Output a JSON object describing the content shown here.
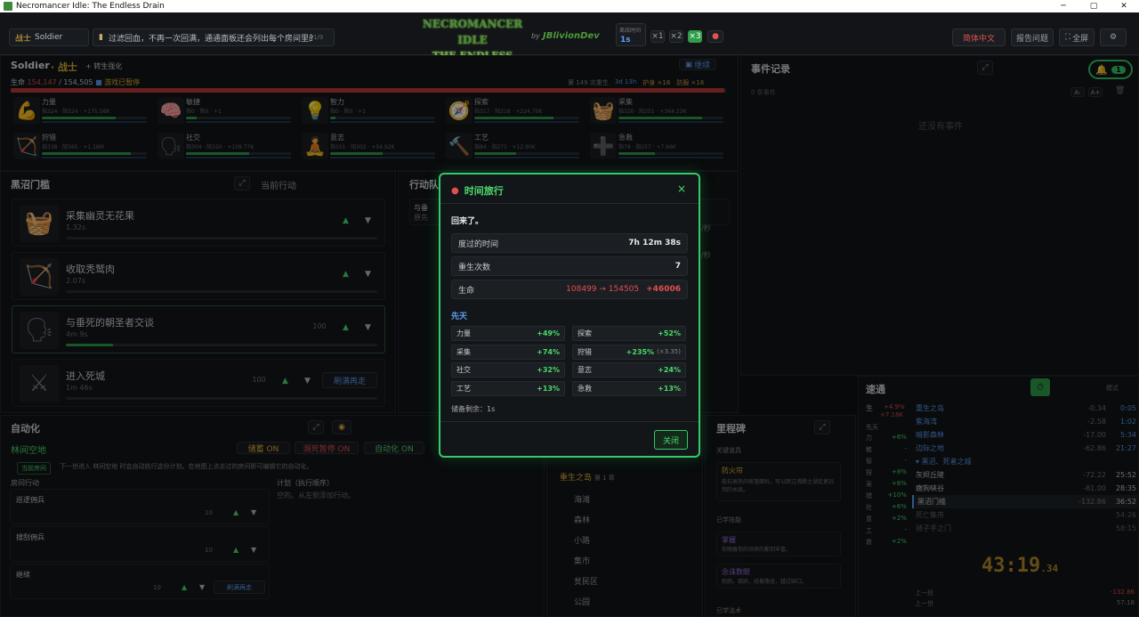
{
  "window": {
    "title": "Necromancer Idle: The Endless Drain",
    "minimize": "─",
    "maximize": "▢",
    "close": "✕"
  },
  "topbar": {
    "class_label": "战士",
    "class_value": "Soldier",
    "hint": "过滤回血，不再一次回满，通通面板还会列出每个房间里的",
    "hint_page": "1/9",
    "logo_line1": "NECROMANCER IDLE",
    "logo_line2": "THE ENDLESS DRAIN",
    "by": "by",
    "author": "JBlivionDev",
    "speed_label": "离线时间",
    "speed_value": "1s",
    "speed_x1": "×1",
    "speed_x2": "×2",
    "speed_x3": "×3",
    "language": "简体中文",
    "report": "报告问题",
    "fullscreen": "全屏"
  },
  "char": {
    "name": "Soldier",
    "title": "· 战士",
    "rebirth_upgrade": "+ 转生强化",
    "continue": "继续",
    "life_label": "生命",
    "life_value": "154,147",
    "life_max": "/ 154,505",
    "status": "游戏已暂停",
    "rebirth_count": "第 149 次重生",
    "time_played": "3d 13h",
    "shield": "护身 ×16",
    "armor": "防服 ×16",
    "life_ratio": 0.998
  },
  "stats": [
    {
      "icon": "💪",
      "name": "力量",
      "sub": "指324 · 阳324 · +175.58K",
      "p": 0.7
    },
    {
      "icon": "🧠",
      "name": "敏捷",
      "sub": "指0 · 阳0 · +1",
      "p": 0.1
    },
    {
      "icon": "💡",
      "name": "智力",
      "sub": "指0 · 阳0 · +1",
      "p": 0.05
    },
    {
      "icon": "🧭",
      "name": "探索",
      "sub": "指317 · 阳318 · +224.70K",
      "p": 0.75
    },
    {
      "icon": "🧺",
      "name": "采集",
      "sub": "指320 · 阳351 · +364.23K",
      "p": 0.8
    },
    {
      "icon": "🏹",
      "name": "狩猎",
      "sub": "指338 · 阳365 · +1.18M",
      "p": 0.85
    },
    {
      "icon": "🗣",
      "name": "社交",
      "sub": "指304 · 阳320 · +109.77K",
      "p": 0.6
    },
    {
      "icon": "🧘",
      "name": "意志",
      "sub": "指101 · 阳302 · +54.92K",
      "p": 0.5
    },
    {
      "icon": "🔨",
      "name": "工艺",
      "sub": "指84 · 阳271 · +12.90K",
      "p": 0.4
    },
    {
      "icon": "➕",
      "name": "急救",
      "sub": "指79 · 阳257 · +7.66K",
      "p": 0.35
    }
  ],
  "location": {
    "title": "黑沼门槛",
    "current_action": "当前行动"
  },
  "actions": [
    {
      "icon": "🧺",
      "name": "采集幽灵无花果",
      "time": "1.32s",
      "count": "",
      "p": 0
    },
    {
      "icon": "🏹",
      "name": "收取秃鹫肉",
      "time": "2.07s",
      "count": "",
      "p": 0
    },
    {
      "icon": "🗣",
      "name": "与垂死的朝圣者交谈",
      "time": "4m 9s",
      "count": "100",
      "p": 0.15
    },
    {
      "icon": "⚔",
      "name": "进入死城",
      "time": "1m 46s",
      "count": "100",
      "p": 0,
      "extra": "刷满再走"
    }
  ],
  "queue": {
    "title": "行动队",
    "item1": "与垂",
    "item1sub": "原先",
    "per": "/秒",
    "per2": "/秒"
  },
  "events": {
    "title": "事件记录",
    "count": "0 条事件",
    "empty": "还没有事件",
    "badge": "1",
    "font_small": "A-",
    "font_big": "A+"
  },
  "automation": {
    "title": "自动化",
    "zone": "林间空地",
    "btn_save": "储蓄 ON",
    "btn_pause": "濒死暂停 ON",
    "btn_auto": "自动化 ON",
    "current": "当前房间",
    "desc": "下一世进入 林间空地 时会自动执行这份计划。在地图上点去过的房间即可编辑它的自动化。",
    "room_actions": "房间行动",
    "plan": "计划（执行顺序）",
    "plan_empty": "空的。从左侧添加行动。",
    "rows": [
      {
        "name": "巡逻佣兵",
        "count": "10"
      },
      {
        "name": "搜刮佣兵",
        "count": "10"
      },
      {
        "name": "继续",
        "count": "10",
        "extra": "刷满再走"
      }
    ]
  },
  "map": {
    "chapter": "重生之岛",
    "chapter_no": "第 1 章",
    "items": [
      "海滩",
      "森林",
      "小路",
      "集市",
      "贫民区",
      "公园"
    ]
  },
  "milestones": {
    "title": "里程碑",
    "key_items": "关键道具",
    "item_name": "防火帘",
    "item_desc": "能抗高热的帐篷面料，可以跨过沸腾之湖走更远到的水底。",
    "learned": "已学技能",
    "skill1": "掌握",
    "skill1desc": "你随着你的领来的都到丰富。",
    "skill2": "念诛数眼",
    "skill2desc": "助跑，跳跃，经着路径，越过缺口。",
    "magic": "已学法术"
  },
  "speedrun": {
    "title": "速通",
    "mode": "模式",
    "life_label": "生",
    "life_delta": "+4.9%",
    "life_delta2": "+7.18K",
    "innate": "先天",
    "deltas": [
      {
        "k": "力",
        "v": "+6%"
      },
      {
        "k": "敏",
        "v": "-"
      },
      {
        "k": "智",
        "v": "-"
      },
      {
        "k": "探",
        "v": "+8%"
      },
      {
        "k": "采",
        "v": "+6%"
      },
      {
        "k": "猎",
        "v": "+10%"
      },
      {
        "k": "社",
        "v": "+6%"
      },
      {
        "k": "意",
        "v": "+2%"
      },
      {
        "k": "工",
        "v": "-"
      },
      {
        "k": "救",
        "v": "+2%"
      }
    ],
    "group1": [
      {
        "n": "重生之岛",
        "a": "-0.34",
        "b": "0:05"
      },
      {
        "n": "紫海湾",
        "a": "-2.58",
        "b": "1:02"
      },
      {
        "n": "暗影森林",
        "a": "-17.00",
        "b": "5:34"
      },
      {
        "n": "边际之地",
        "a": "-62.86",
        "b": "21:27"
      }
    ],
    "group2_title": "黑沼、死者之城",
    "group2": [
      {
        "n": "灰烬丘陵",
        "a": "-72.22",
        "b": "25:52"
      },
      {
        "n": "瘸狗峡谷",
        "a": "-81.00",
        "b": "28:35"
      },
      {
        "n": "黑沼门槛",
        "a": "-132.86",
        "b": "36:52"
      },
      {
        "n": "死亡集市",
        "a": "",
        "b": "54:26"
      },
      {
        "n": "骑子手之门",
        "a": "",
        "b": "58:15"
      }
    ],
    "timer": "43:19",
    "timer_ms": ".34",
    "prev_label": "上一段",
    "prev_value": "-132.86",
    "last_label": "上一世",
    "last_value": "57:18"
  },
  "modal": {
    "title": "时间旅行",
    "close": "×",
    "msg": "回来了。",
    "elapsed_label": "度过的时间",
    "elapsed_value": "7h 12m 38s",
    "rebirths_label": "重生次数",
    "rebirths_value": "7",
    "life_label": "生命",
    "life_value": "108499 → 154505",
    "life_gain": "+46006",
    "innate": "先天",
    "cells": [
      {
        "k": "力量",
        "v": "+49%"
      },
      {
        "k": "探索",
        "v": "+52%"
      },
      {
        "k": "采集",
        "v": "+74%"
      },
      {
        "k": "狩猎",
        "v": "+235%",
        "x": "(×3.35)"
      },
      {
        "k": "社交",
        "v": "+32%"
      },
      {
        "k": "意志",
        "v": "+24%"
      },
      {
        "k": "工艺",
        "v": "+13%"
      },
      {
        "k": "急救",
        "v": "+13%"
      }
    ],
    "saved": "储备剩余：1s",
    "close_button": "关闭"
  }
}
